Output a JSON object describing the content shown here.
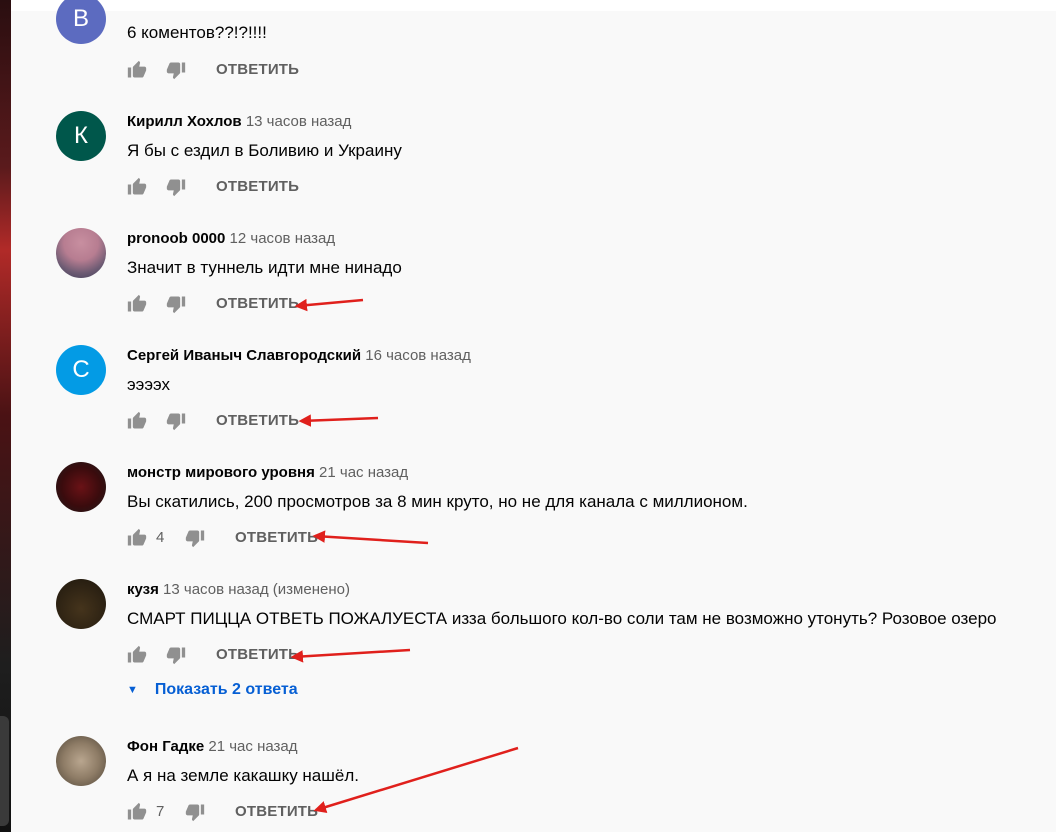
{
  "comments": [
    {
      "author": "",
      "time": "",
      "text": "6 коментов??!?!!!!",
      "avatar_letter": "В",
      "avatar_color": "#5c6bc0",
      "likes": "",
      "reply": "ОТВЕТИТЬ"
    },
    {
      "author": "Кирилл Хохлов",
      "time": "13 часов назад",
      "text": "Я бы с ездил в Боливию и Украину",
      "avatar_letter": "К",
      "avatar_color": "#00574b",
      "likes": "",
      "reply": "ОТВЕТИТЬ"
    },
    {
      "author": "pronoob 0000",
      "time": "12 часов назад",
      "text": "Значит в туннель идти мне нинадо",
      "avatar_letter": "",
      "avatar_color": "",
      "likes": "",
      "reply": "ОТВЕТИТЬ"
    },
    {
      "author": "Сергей Иваныч Славгородский",
      "time": "16 часов назад",
      "text": "ээээх",
      "avatar_letter": "С",
      "avatar_color": "#039be5",
      "likes": "",
      "reply": "ОТВЕТИТЬ"
    },
    {
      "author": "монстр мирового уровня",
      "time": "21 час назад",
      "text": "Вы скатились, 200 просмотров за 8 мин круто, но не для канала с миллионом.",
      "avatar_letter": "",
      "avatar_color": "",
      "likes": "4",
      "reply": "ОТВЕТИТЬ"
    },
    {
      "author": "кузя",
      "time": "13 часов назад (изменено)",
      "text": "СМАРТ ПИЦЦА ОТВЕТЬ ПОЖАЛУЕСТА изза большого кол-во соли там не возможно утонуть? Розовое озеро",
      "avatar_letter": "",
      "avatar_color": "",
      "likes": "",
      "reply": "ОТВЕТИТЬ"
    },
    {
      "author": "Фон Гадке",
      "time": "21 час назад",
      "text": "А я на земле какашку нашёл.",
      "avatar_letter": "",
      "avatar_color": "",
      "likes": "7",
      "reply": "ОТВЕТИТЬ"
    }
  ],
  "show_replies": "Показать 2 ответа",
  "icons": {
    "like": "thumb-up-icon",
    "dislike": "thumb-down-icon",
    "expand": "caret-down-icon"
  },
  "colors": {
    "accent": "#065fd4",
    "annotation_arrow": "#e0201c",
    "text": "#030303",
    "secondary": "#606060"
  }
}
